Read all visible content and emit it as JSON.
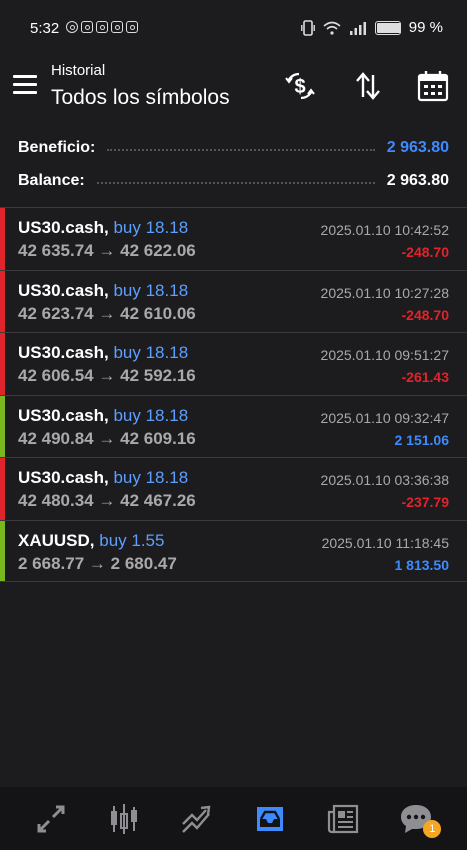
{
  "status_bar": {
    "time": "5:32",
    "battery": "99 %",
    "battery_level": 0.99,
    "left_icons": [
      "messenger-icon",
      "instagram-icon",
      "instagram-icon",
      "instagram-icon",
      "chat-icon"
    ],
    "right_icons": [
      "vibrate-icon",
      "wifi-icon",
      "signal-icon",
      "battery-icon"
    ]
  },
  "header": {
    "subtitle": "Historial",
    "title": "Todos los símbolos",
    "icons": [
      "menu-icon",
      "currency-exchange-icon",
      "sort-icon",
      "calendar-icon"
    ]
  },
  "summary": {
    "profit_label": "Beneficio:",
    "profit_value": "2 963.80",
    "balance_label": "Balance:",
    "balance_value": "2 963.80"
  },
  "deals": [
    {
      "symbol": "US30.cash,",
      "type": "buy 18.18",
      "open": "42 635.74",
      "close": "42 622.06",
      "time": "2025.01.10 10:42:52",
      "profit": "-248.70",
      "direction": "loss"
    },
    {
      "symbol": "US30.cash,",
      "type": "buy 18.18",
      "open": "42 623.74",
      "close": "42 610.06",
      "time": "2025.01.10 10:27:28",
      "profit": "-248.70",
      "direction": "loss"
    },
    {
      "symbol": "US30.cash,",
      "type": "buy 18.18",
      "open": "42 606.54",
      "close": "42 592.16",
      "time": "2025.01.10 09:51:27",
      "profit": "-261.43",
      "direction": "loss"
    },
    {
      "symbol": "US30.cash,",
      "type": "buy 18.18",
      "open": "42 490.84",
      "close": "42 609.16",
      "time": "2025.01.10 09:32:47",
      "profit": "2 151.06",
      "direction": "gain"
    },
    {
      "symbol": "US30.cash,",
      "type": "buy 18.18",
      "open": "42 480.34",
      "close": "42 467.26",
      "time": "2025.01.10 03:36:38",
      "profit": "-237.79",
      "direction": "loss"
    },
    {
      "symbol": "XAUUSD,",
      "type": "buy 1.55",
      "open": "2 668.77",
      "close": "2 680.47",
      "time": "2025.01.10 11:18:45",
      "profit": "1 813.50",
      "direction": "gain"
    }
  ],
  "price_arrow": "→",
  "bottom_nav": {
    "items": [
      "quotes-icon",
      "chart-icon",
      "trade-icon",
      "history-icon",
      "news-icon",
      "messages-icon"
    ],
    "active": "history-icon",
    "messages_badge": "1"
  },
  "colors": {
    "background": "#1c1c1e",
    "accent_blue": "#3d8bff",
    "type_blue": "#5c9fff",
    "loss_red": "#e0242b",
    "gain_green": "#78b81e",
    "muted": "#a9a9ab",
    "badge_orange": "#f5a623"
  }
}
